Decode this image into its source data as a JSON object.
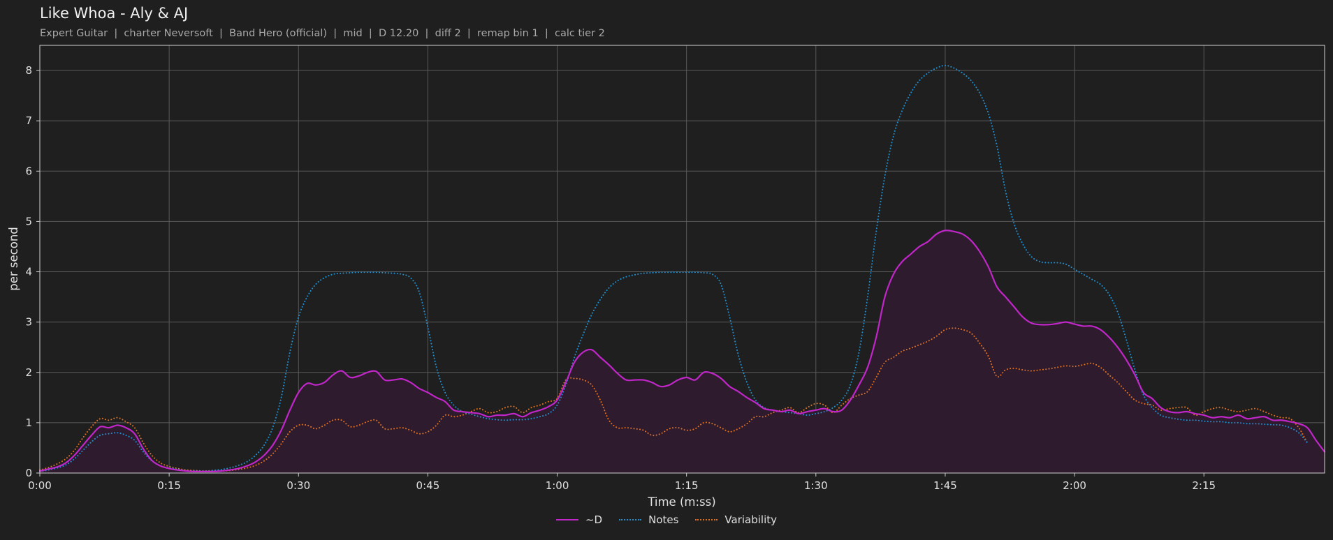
{
  "header": {
    "title": "Like Whoa - Aly & AJ",
    "subtitle": "Expert Guitar  |  charter Neversoft  |  Band Hero (official)  |  mid  |  D 12.20  |  diff 2  |  remap bin 1  |  calc tier 2"
  },
  "chart_data": {
    "type": "line",
    "xlabel": "Time (m:ss)",
    "ylabel": "per second",
    "xlim": [
      0,
      149
    ],
    "ylim": [
      0,
      8.5
    ],
    "x_ticks": [
      0,
      15,
      30,
      45,
      60,
      75,
      90,
      105,
      120,
      135
    ],
    "x_tick_labels": [
      "0:00",
      "0:15",
      "0:30",
      "0:45",
      "1:00",
      "1:15",
      "1:30",
      "1:45",
      "2:00",
      "2:15"
    ],
    "y_ticks": [
      0,
      1,
      2,
      3,
      4,
      5,
      6,
      7,
      8
    ],
    "y_tick_labels": [
      "0",
      "1",
      "2",
      "3",
      "4",
      "5",
      "6",
      "7",
      "8"
    ],
    "grid": true,
    "legend_position": "bottom-center",
    "x": [
      0,
      1,
      2,
      3,
      4,
      5,
      6,
      7,
      8,
      9,
      10,
      11,
      12,
      13,
      14,
      15,
      16,
      17,
      18,
      19,
      20,
      21,
      22,
      23,
      24,
      25,
      26,
      27,
      28,
      29,
      30,
      31,
      32,
      33,
      34,
      35,
      36,
      37,
      38,
      39,
      40,
      41,
      42,
      43,
      44,
      45,
      46,
      47,
      48,
      49,
      50,
      51,
      52,
      53,
      54,
      55,
      56,
      57,
      58,
      59,
      60,
      61,
      62,
      63,
      64,
      65,
      66,
      67,
      68,
      69,
      70,
      71,
      72,
      73,
      74,
      75,
      76,
      77,
      78,
      79,
      80,
      81,
      82,
      83,
      84,
      85,
      86,
      87,
      88,
      89,
      90,
      91,
      92,
      93,
      94,
      95,
      96,
      97,
      98,
      99,
      100,
      101,
      102,
      103,
      104,
      105,
      106,
      107,
      108,
      109,
      110,
      111,
      112,
      113,
      114,
      115,
      116,
      117,
      118,
      119,
      120,
      121,
      122,
      123,
      124,
      125,
      126,
      127,
      128,
      129,
      130,
      131,
      132,
      133,
      134,
      135,
      136,
      137,
      138,
      139,
      140,
      141,
      142,
      143,
      144,
      145,
      146,
      147,
      148,
      149
    ],
    "series": [
      {
        "name": "~D",
        "color": "#c026c8",
        "style": "solid",
        "fill": true,
        "values": [
          0.04,
          0.08,
          0.12,
          0.2,
          0.35,
          0.55,
          0.75,
          0.92,
          0.9,
          0.95,
          0.9,
          0.78,
          0.48,
          0.25,
          0.14,
          0.09,
          0.06,
          0.04,
          0.03,
          0.03,
          0.03,
          0.04,
          0.06,
          0.09,
          0.14,
          0.22,
          0.35,
          0.55,
          0.85,
          1.25,
          1.6,
          1.78,
          1.75,
          1.8,
          1.95,
          2.03,
          1.9,
          1.93,
          2.0,
          2.02,
          1.85,
          1.85,
          1.87,
          1.8,
          1.68,
          1.6,
          1.5,
          1.42,
          1.25,
          1.22,
          1.2,
          1.18,
          1.12,
          1.15,
          1.15,
          1.18,
          1.12,
          1.2,
          1.25,
          1.32,
          1.45,
          1.8,
          2.2,
          2.4,
          2.45,
          2.3,
          2.15,
          1.98,
          1.85,
          1.85,
          1.85,
          1.8,
          1.72,
          1.75,
          1.85,
          1.9,
          1.85,
          2.0,
          1.98,
          1.88,
          1.72,
          1.62,
          1.5,
          1.4,
          1.28,
          1.25,
          1.22,
          1.25,
          1.18,
          1.22,
          1.25,
          1.28,
          1.22,
          1.25,
          1.45,
          1.75,
          2.1,
          2.7,
          3.5,
          3.95,
          4.2,
          4.35,
          4.5,
          4.6,
          4.75,
          4.82,
          4.8,
          4.75,
          4.62,
          4.4,
          4.1,
          3.7,
          3.5,
          3.3,
          3.1,
          2.98,
          2.95,
          2.95,
          2.97,
          3.0,
          2.96,
          2.92,
          2.92,
          2.85,
          2.7,
          2.5,
          2.25,
          1.95,
          1.6,
          1.48,
          1.3,
          1.22,
          1.2,
          1.22,
          1.18,
          1.15,
          1.1,
          1.12,
          1.1,
          1.15,
          1.08,
          1.1,
          1.12,
          1.05,
          1.05,
          1.02,
          0.98,
          0.9,
          0.65,
          0.42
        ]
      },
      {
        "name": "Notes",
        "color": "#1f8fd0",
        "style": "dotted",
        "fill": false,
        "values": [
          0.03,
          0.06,
          0.1,
          0.16,
          0.28,
          0.45,
          0.62,
          0.75,
          0.78,
          0.8,
          0.75,
          0.65,
          0.42,
          0.24,
          0.14,
          0.1,
          0.07,
          0.05,
          0.04,
          0.04,
          0.05,
          0.07,
          0.1,
          0.15,
          0.22,
          0.35,
          0.55,
          0.9,
          1.5,
          2.4,
          3.1,
          3.5,
          3.75,
          3.88,
          3.95,
          3.97,
          3.98,
          3.99,
          3.99,
          3.99,
          3.98,
          3.97,
          3.95,
          3.88,
          3.6,
          2.9,
          2.1,
          1.6,
          1.35,
          1.22,
          1.17,
          1.12,
          1.08,
          1.06,
          1.05,
          1.06,
          1.06,
          1.08,
          1.12,
          1.18,
          1.35,
          1.75,
          2.3,
          2.75,
          3.15,
          3.45,
          3.68,
          3.82,
          3.9,
          3.94,
          3.97,
          3.98,
          3.99,
          3.99,
          3.99,
          3.99,
          3.99,
          3.98,
          3.95,
          3.75,
          3.1,
          2.35,
          1.8,
          1.45,
          1.3,
          1.25,
          1.22,
          1.2,
          1.18,
          1.15,
          1.18,
          1.22,
          1.3,
          1.45,
          1.75,
          2.4,
          3.5,
          4.8,
          5.9,
          6.7,
          7.2,
          7.55,
          7.8,
          7.95,
          8.05,
          8.1,
          8.05,
          7.95,
          7.8,
          7.55,
          7.15,
          6.5,
          5.6,
          4.95,
          4.55,
          4.3,
          4.2,
          4.18,
          4.18,
          4.15,
          4.05,
          3.95,
          3.85,
          3.75,
          3.55,
          3.2,
          2.65,
          2.05,
          1.55,
          1.3,
          1.15,
          1.1,
          1.07,
          1.05,
          1.05,
          1.03,
          1.02,
          1.02,
          1.0,
          1.0,
          0.98,
          0.98,
          0.97,
          0.96,
          0.95,
          0.9,
          0.8,
          0.6,
          0.4
        ]
      },
      {
        "name": "Variability",
        "color": "#e07020",
        "style": "dotted",
        "fill": false,
        "values": [
          0.06,
          0.11,
          0.18,
          0.28,
          0.45,
          0.7,
          0.92,
          1.08,
          1.05,
          1.1,
          1.02,
          0.9,
          0.6,
          0.35,
          0.2,
          0.13,
          0.09,
          0.06,
          0.05,
          0.04,
          0.04,
          0.04,
          0.05,
          0.07,
          0.1,
          0.15,
          0.24,
          0.38,
          0.58,
          0.82,
          0.95,
          0.95,
          0.88,
          0.95,
          1.05,
          1.05,
          0.92,
          0.95,
          1.02,
          1.05,
          0.88,
          0.88,
          0.9,
          0.85,
          0.78,
          0.82,
          0.95,
          1.15,
          1.12,
          1.15,
          1.22,
          1.28,
          1.2,
          1.22,
          1.3,
          1.32,
          1.2,
          1.3,
          1.35,
          1.42,
          1.48,
          1.85,
          1.88,
          1.85,
          1.75,
          1.45,
          1.05,
          0.9,
          0.9,
          0.88,
          0.85,
          0.75,
          0.78,
          0.88,
          0.9,
          0.85,
          0.88,
          1.0,
          0.98,
          0.9,
          0.82,
          0.88,
          0.98,
          1.12,
          1.12,
          1.2,
          1.25,
          1.3,
          1.2,
          1.3,
          1.38,
          1.35,
          1.2,
          1.35,
          1.48,
          1.55,
          1.62,
          1.9,
          2.2,
          2.3,
          2.42,
          2.48,
          2.55,
          2.62,
          2.72,
          2.85,
          2.88,
          2.85,
          2.78,
          2.58,
          2.32,
          1.92,
          2.05,
          2.08,
          2.05,
          2.03,
          2.05,
          2.07,
          2.1,
          2.13,
          2.12,
          2.15,
          2.18,
          2.1,
          1.95,
          1.8,
          1.62,
          1.45,
          1.38,
          1.35,
          1.25,
          1.28,
          1.3,
          1.3,
          1.15,
          1.22,
          1.28,
          1.3,
          1.25,
          1.22,
          1.25,
          1.28,
          1.22,
          1.15,
          1.1,
          1.08,
          0.9,
          0.6,
          0.3
        ]
      }
    ]
  }
}
